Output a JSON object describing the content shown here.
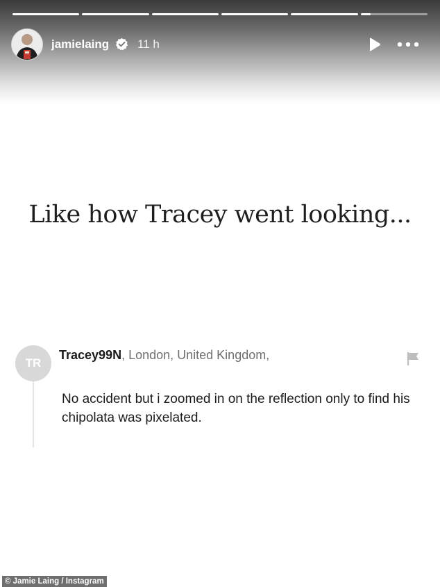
{
  "story": {
    "progress": [
      1,
      1,
      1,
      1,
      1,
      0.15
    ],
    "header": {
      "username": "jamielaing",
      "verified_icon": "verified-badge-icon",
      "time": "11 h",
      "play_icon": "play-icon",
      "more_icon": "more-icon"
    },
    "headline": "Like how Tracey went looking...",
    "comment": {
      "avatar_initials": "TR",
      "username": "Tracey99N",
      "location": ", London, United Kingdom,",
      "text": "No accident but i zoomed in on the reflection only to find his chipolata was pixelated.",
      "flag_icon": "flag-icon"
    }
  },
  "credit": "© Jamie Laing / Instagram",
  "colors": {
    "verified": "#3897f0",
    "text": "#1b1b1b",
    "muted": "#6f6f6f",
    "avatar_bg": "#d8d8d8"
  }
}
